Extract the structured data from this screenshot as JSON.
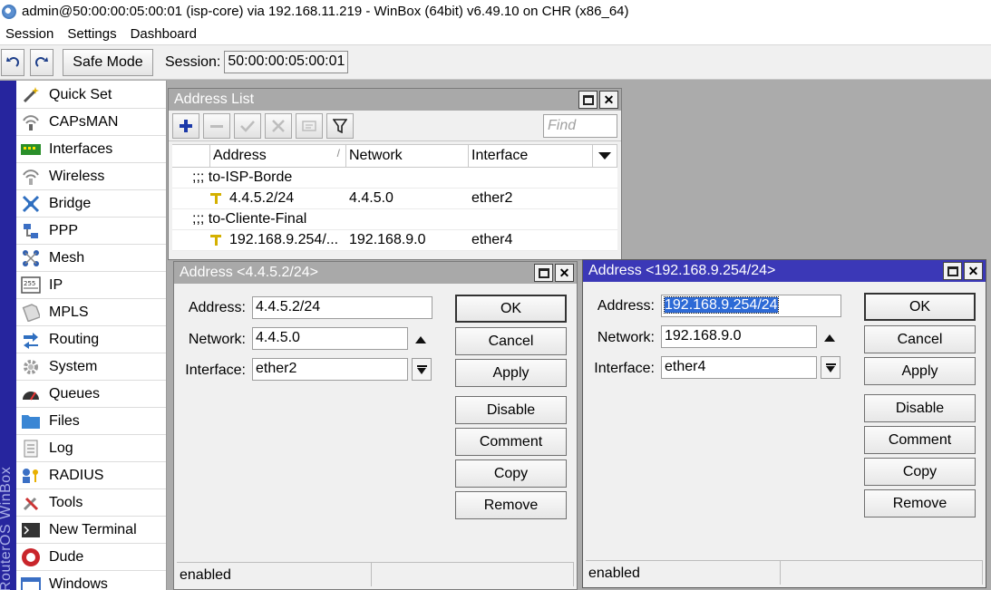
{
  "titlebar": {
    "text": "admin@50:00:00:05:00:01 (isp-core) via 192.168.11.219 - WinBox (64bit) v6.49.10 on CHR (x86_64)"
  },
  "menubar": {
    "items": [
      "Session",
      "Settings",
      "Dashboard"
    ]
  },
  "toolbar": {
    "undo_icon": "undo-icon",
    "redo_icon": "redo-icon",
    "safe_mode": "Safe Mode",
    "session_label": "Session:",
    "session_value": "50:00:00:05:00:01"
  },
  "sidebar": {
    "vertical_text": "RouterOS WinBox",
    "items": [
      {
        "label": "Quick Set",
        "icon": "wand-icon",
        "submenu": false
      },
      {
        "label": "CAPsMAN",
        "icon": "antenna-icon",
        "submenu": false
      },
      {
        "label": "Interfaces",
        "icon": "interfaces-icon",
        "submenu": false
      },
      {
        "label": "Wireless",
        "icon": "wireless-icon",
        "submenu": false
      },
      {
        "label": "Bridge",
        "icon": "bridge-icon",
        "submenu": false
      },
      {
        "label": "PPP",
        "icon": "ppp-icon",
        "submenu": false
      },
      {
        "label": "Mesh",
        "icon": "mesh-icon",
        "submenu": false
      },
      {
        "label": "IP",
        "icon": "ip-icon",
        "submenu": true
      },
      {
        "label": "MPLS",
        "icon": "mpls-icon",
        "submenu": true
      },
      {
        "label": "Routing",
        "icon": "routing-icon",
        "submenu": true
      },
      {
        "label": "System",
        "icon": "gear-icon",
        "submenu": true
      },
      {
        "label": "Queues",
        "icon": "queues-icon",
        "submenu": false
      },
      {
        "label": "Files",
        "icon": "folder-icon",
        "submenu": false
      },
      {
        "label": "Log",
        "icon": "log-icon",
        "submenu": false
      },
      {
        "label": "RADIUS",
        "icon": "radius-icon",
        "submenu": false
      },
      {
        "label": "Tools",
        "icon": "tools-icon",
        "submenu": true
      },
      {
        "label": "New Terminal",
        "icon": "terminal-icon",
        "submenu": false
      },
      {
        "label": "Dude",
        "icon": "dude-icon",
        "submenu": true
      },
      {
        "label": "Windows",
        "icon": "windows-icon",
        "submenu": true
      }
    ]
  },
  "address_list": {
    "title": "Address List",
    "find_placeholder": "Find",
    "columns": [
      "Address",
      "Network",
      "Interface"
    ],
    "rows": [
      {
        "type": "comment",
        "text": ";;; to-ISP-Borde"
      },
      {
        "type": "entry",
        "address": "4.4.5.2/24",
        "network": "4.4.5.0",
        "interface": "ether2"
      },
      {
        "type": "comment",
        "text": ";;; to-Cliente-Final"
      },
      {
        "type": "entry",
        "address": "192.168.9.254/...",
        "network": "192.168.9.0",
        "interface": "ether4"
      }
    ]
  },
  "dialog1": {
    "title": "Address <4.4.5.2/24>",
    "address_label": "Address:",
    "address_value": "4.4.5.2/24",
    "network_label": "Network:",
    "network_value": "4.4.5.0",
    "interface_label": "Interface:",
    "interface_value": "ether2",
    "buttons": {
      "ok": "OK",
      "cancel": "Cancel",
      "apply": "Apply",
      "disable": "Disable",
      "comment": "Comment",
      "copy": "Copy",
      "remove": "Remove"
    },
    "status": "enabled"
  },
  "dialog2": {
    "title": "Address <192.168.9.254/24>",
    "address_label": "Address:",
    "address_value": "192.168.9.254/24",
    "network_label": "Network:",
    "network_value": "192.168.9.0",
    "interface_label": "Interface:",
    "interface_value": "ether4",
    "buttons": {
      "ok": "OK",
      "cancel": "Cancel",
      "apply": "Apply",
      "disable": "Disable",
      "comment": "Comment",
      "copy": "Copy",
      "remove": "Remove"
    },
    "status": "enabled"
  },
  "colors": {
    "active_title": "#3b38b7",
    "inactive_title": "#a9a9a9",
    "sidebar_bar": "#26259e",
    "selection": "#2d6ad6"
  }
}
